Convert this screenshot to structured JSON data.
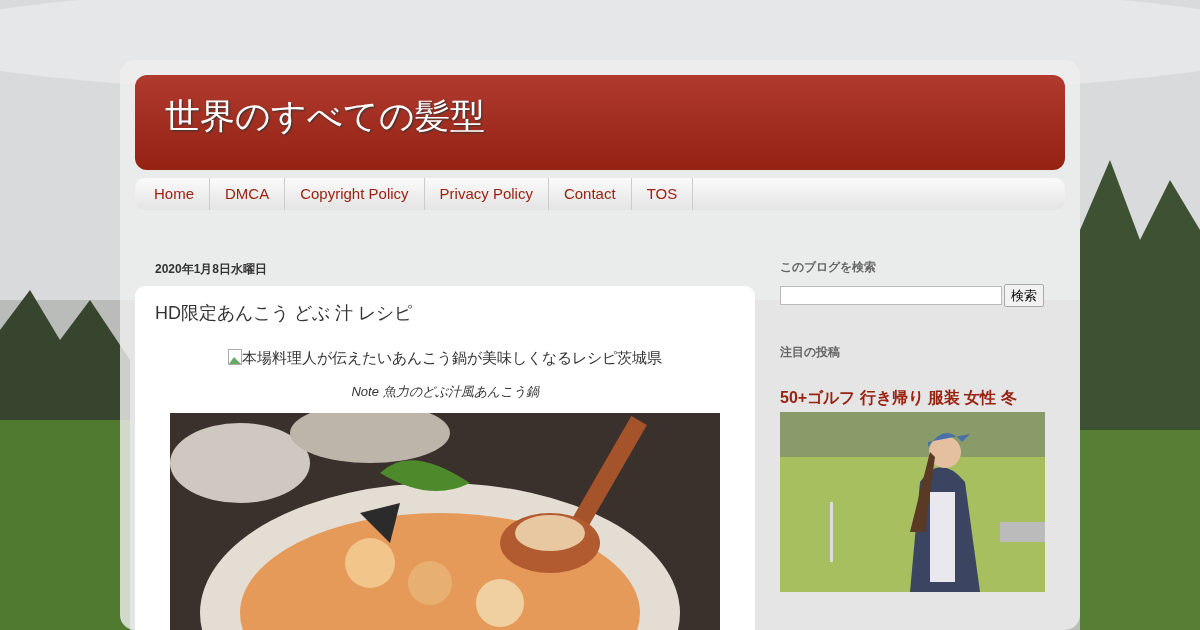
{
  "blog": {
    "title": "世界のすべての髪型"
  },
  "nav": [
    {
      "label": "Home"
    },
    {
      "label": "DMCA"
    },
    {
      "label": "Copyright Policy"
    },
    {
      "label": "Privacy Policy"
    },
    {
      "label": "Contact"
    },
    {
      "label": "TOS"
    }
  ],
  "post": {
    "date": "2020年1月8日水曜日",
    "title": "HD限定あんこう どぶ 汁 レシピ",
    "image_alt": "本場料理人が伝えたいあんこう鍋が美味しくなるレシピ茨城県",
    "caption": "Note 魚力のどぶ汁風あんこう鍋"
  },
  "sidebar": {
    "search": {
      "heading": "このブログを検索",
      "button": "検索"
    },
    "featured": {
      "heading": "注目の投稿",
      "title": "50+ゴルフ 行き帰り 服装 女性 冬"
    }
  }
}
